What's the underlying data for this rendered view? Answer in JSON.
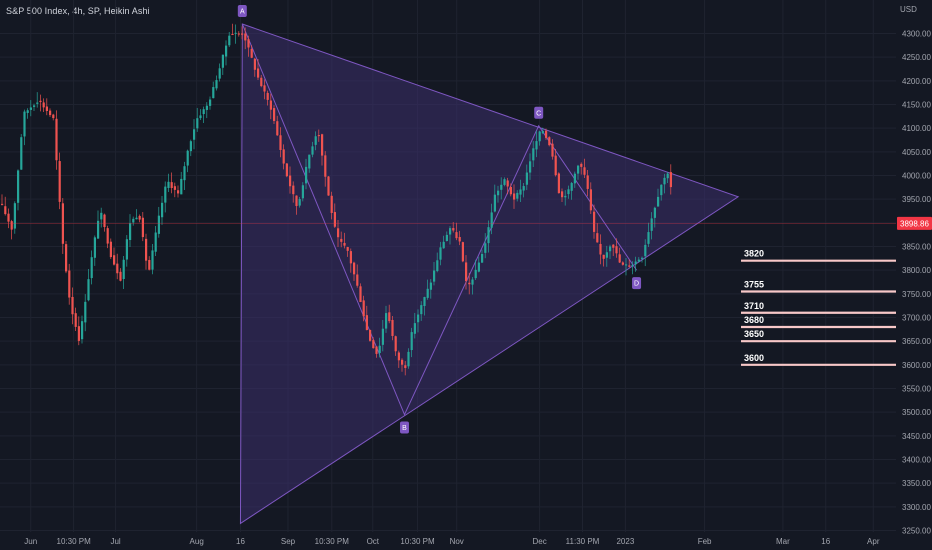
{
  "header": {
    "title": "S&P 500 Index, 4h, SP, Heikin Ashi"
  },
  "colors": {
    "background": "#141823",
    "grid": "#1f2330",
    "up": "#26a69a",
    "down": "#ef5350",
    "pattern_fill": "#3a2f6b",
    "pattern_line": "#7e57c2",
    "level_line": "#f8c8c8",
    "price_tag": "#f23645"
  },
  "chart_data": {
    "type": "candlestick",
    "title": "S&P 500 Index, 4h, SP, Heikin Ashi",
    "currency": "USD",
    "ylim": [
      3250,
      4350
    ],
    "y_ticks": [
      3250,
      3300,
      3350,
      3400,
      3450,
      3500,
      3550,
      3600,
      3650,
      3700,
      3750,
      3800,
      3850,
      3900,
      3950,
      4000,
      4050,
      4100,
      4150,
      4200,
      4250,
      4300
    ],
    "x_labels": [
      {
        "label": "Jun",
        "pos": 0.033
      },
      {
        "label": "10:30 PM",
        "pos": 0.079
      },
      {
        "label": "Jul",
        "pos": 0.124
      },
      {
        "label": "Aug",
        "pos": 0.211
      },
      {
        "label": "16",
        "pos": 0.258
      },
      {
        "label": "Sep",
        "pos": 0.309
      },
      {
        "label": "10:30 PM",
        "pos": 0.356
      },
      {
        "label": "Oct",
        "pos": 0.4
      },
      {
        "label": "10:30 PM",
        "pos": 0.448
      },
      {
        "label": "Nov",
        "pos": 0.49
      },
      {
        "label": "Dec",
        "pos": 0.579
      },
      {
        "label": "11:30 PM",
        "pos": 0.625
      },
      {
        "label": "2023",
        "pos": 0.671
      },
      {
        "label": "Feb",
        "pos": 0.756
      },
      {
        "label": "Mar",
        "pos": 0.84
      },
      {
        "label": "16",
        "pos": 0.886
      },
      {
        "label": "Apr",
        "pos": 0.937
      }
    ],
    "price_path": [
      [
        0.0,
        3940
      ],
      [
        0.012,
        3885
      ],
      [
        0.024,
        4130
      ],
      [
        0.04,
        4160
      ],
      [
        0.056,
        4120
      ],
      [
        0.066,
        3860
      ],
      [
        0.074,
        3730
      ],
      [
        0.084,
        3650
      ],
      [
        0.095,
        3800
      ],
      [
        0.106,
        3930
      ],
      [
        0.118,
        3830
      ],
      [
        0.128,
        3780
      ],
      [
        0.138,
        3900
      ],
      [
        0.148,
        3920
      ],
      [
        0.158,
        3790
      ],
      [
        0.168,
        3900
      ],
      [
        0.178,
        3990
      ],
      [
        0.19,
        3960
      ],
      [
        0.2,
        4050
      ],
      [
        0.21,
        4120
      ],
      [
        0.222,
        4150
      ],
      [
        0.232,
        4210
      ],
      [
        0.245,
        4300
      ],
      [
        0.26,
        4300
      ],
      [
        0.275,
        4210
      ],
      [
        0.29,
        4140
      ],
      [
        0.305,
        4010
      ],
      [
        0.318,
        3930
      ],
      [
        0.33,
        4040
      ],
      [
        0.34,
        4100
      ],
      [
        0.35,
        3970
      ],
      [
        0.36,
        3870
      ],
      [
        0.372,
        3840
      ],
      [
        0.383,
        3760
      ],
      [
        0.394,
        3660
      ],
      [
        0.404,
        3620
      ],
      [
        0.414,
        3720
      ],
      [
        0.424,
        3620
      ],
      [
        0.433,
        3590
      ],
      [
        0.442,
        3680
      ],
      [
        0.452,
        3730
      ],
      [
        0.462,
        3780
      ],
      [
        0.472,
        3850
      ],
      [
        0.482,
        3890
      ],
      [
        0.492,
        3860
      ],
      [
        0.5,
        3760
      ],
      [
        0.51,
        3800
      ],
      [
        0.52,
        3860
      ],
      [
        0.53,
        3960
      ],
      [
        0.54,
        3990
      ],
      [
        0.55,
        3950
      ],
      [
        0.56,
        3975
      ],
      [
        0.57,
        4050
      ],
      [
        0.58,
        4100
      ],
      [
        0.59,
        4060
      ],
      [
        0.6,
        3950
      ],
      [
        0.61,
        3970
      ],
      [
        0.62,
        4030
      ],
      [
        0.628,
        3990
      ],
      [
        0.636,
        3880
      ],
      [
        0.645,
        3820
      ],
      [
        0.655,
        3860
      ],
      [
        0.665,
        3810
      ],
      [
        0.676,
        3810
      ],
      [
        0.688,
        3830
      ],
      [
        0.698,
        3910
      ],
      [
        0.708,
        3980
      ],
      [
        0.716,
        4010
      ],
      [
        0.722,
        3935
      ]
    ],
    "pattern": {
      "type": "triangle",
      "points": [
        {
          "label": "A",
          "pos": 0.26,
          "value": 4320
        },
        {
          "label": "B",
          "pos": 0.434,
          "value": 3495
        },
        {
          "label": "C",
          "pos": 0.578,
          "value": 4105
        },
        {
          "label": "D",
          "pos": 0.683,
          "value": 3800
        }
      ],
      "apex": {
        "pos": 0.792,
        "value": 3955
      },
      "base_bottom": {
        "pos": 0.258,
        "value": 3265
      }
    },
    "levels": [
      {
        "label": "3820",
        "value": 3820
      },
      {
        "label": "3755",
        "value": 3755
      },
      {
        "label": "3710",
        "value": 3710
      },
      {
        "label": "3680",
        "value": 3680
      },
      {
        "label": "3650",
        "value": 3650
      },
      {
        "label": "3600",
        "value": 3600
      }
    ],
    "last_price": {
      "label": "3898.86",
      "value": 3898.86
    }
  }
}
